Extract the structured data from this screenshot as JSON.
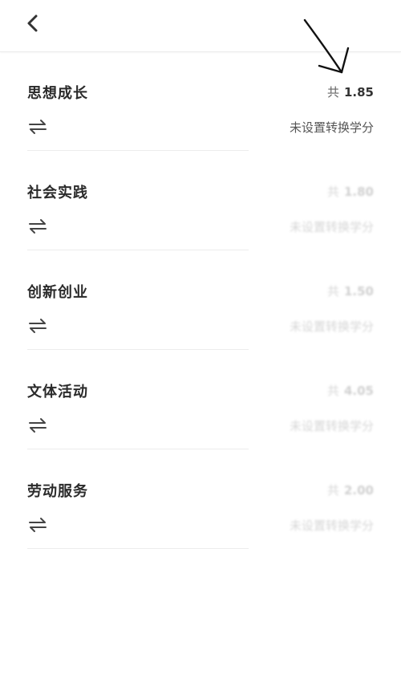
{
  "header": {
    "back_icon": "chevron-left-icon"
  },
  "categories": [
    {
      "title": "思想成长",
      "total_prefix": "共",
      "total_value": "1.85",
      "convert_text": "未设置转换学分"
    },
    {
      "title": "社会实践",
      "total_prefix": "共",
      "total_value": "1.80",
      "convert_text": "未设置转换学分"
    },
    {
      "title": "创新创业",
      "total_prefix": "共",
      "total_value": "1.50",
      "convert_text": "未设置转换学分"
    },
    {
      "title": "文体活动",
      "total_prefix": "共",
      "total_value": "4.05",
      "convert_text": "未设置转换学分"
    },
    {
      "title": "劳动服务",
      "total_prefix": "共",
      "total_value": "2.00",
      "convert_text": "未设置转换学分"
    }
  ],
  "icons": {
    "swap": "swap-arrows-icon",
    "annotation": "hand-drawn-arrow-icon"
  }
}
